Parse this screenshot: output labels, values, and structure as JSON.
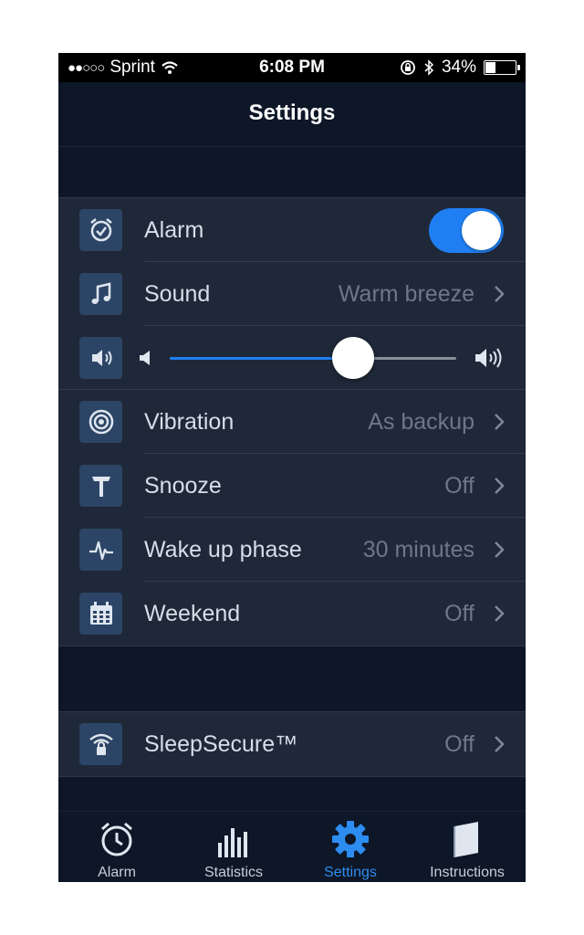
{
  "status_bar": {
    "signal": "●●○○○",
    "carrier": "Sprint",
    "time": "6:08 PM",
    "battery_percent": "34%",
    "battery_level": 0.34
  },
  "nav": {
    "title": "Settings"
  },
  "settings": {
    "alarm": {
      "label": "Alarm",
      "enabled": true
    },
    "sound": {
      "label": "Sound",
      "value": "Warm breeze"
    },
    "volume": {
      "level": 0.64
    },
    "vibration": {
      "label": "Vibration",
      "value": "As backup"
    },
    "snooze": {
      "label": "Snooze",
      "value": "Off"
    },
    "wake_up_phase": {
      "label": "Wake up phase",
      "value": "30 minutes"
    },
    "weekend": {
      "label": "Weekend",
      "value": "Off"
    }
  },
  "secure": {
    "label": "SleepSecure™",
    "value": "Off"
  },
  "tabs": [
    {
      "label": "Alarm",
      "icon": "alarm-clock-icon"
    },
    {
      "label": "Statistics",
      "icon": "statistics-bars-icon"
    },
    {
      "label": "Settings",
      "icon": "gear-icon",
      "active": true
    },
    {
      "label": "Instructions",
      "icon": "book-icon"
    }
  ],
  "colors": {
    "accent": "#1f7ef2",
    "background": "#0d1727",
    "cell": "#1f2838",
    "icon_box": "#2c4566"
  }
}
